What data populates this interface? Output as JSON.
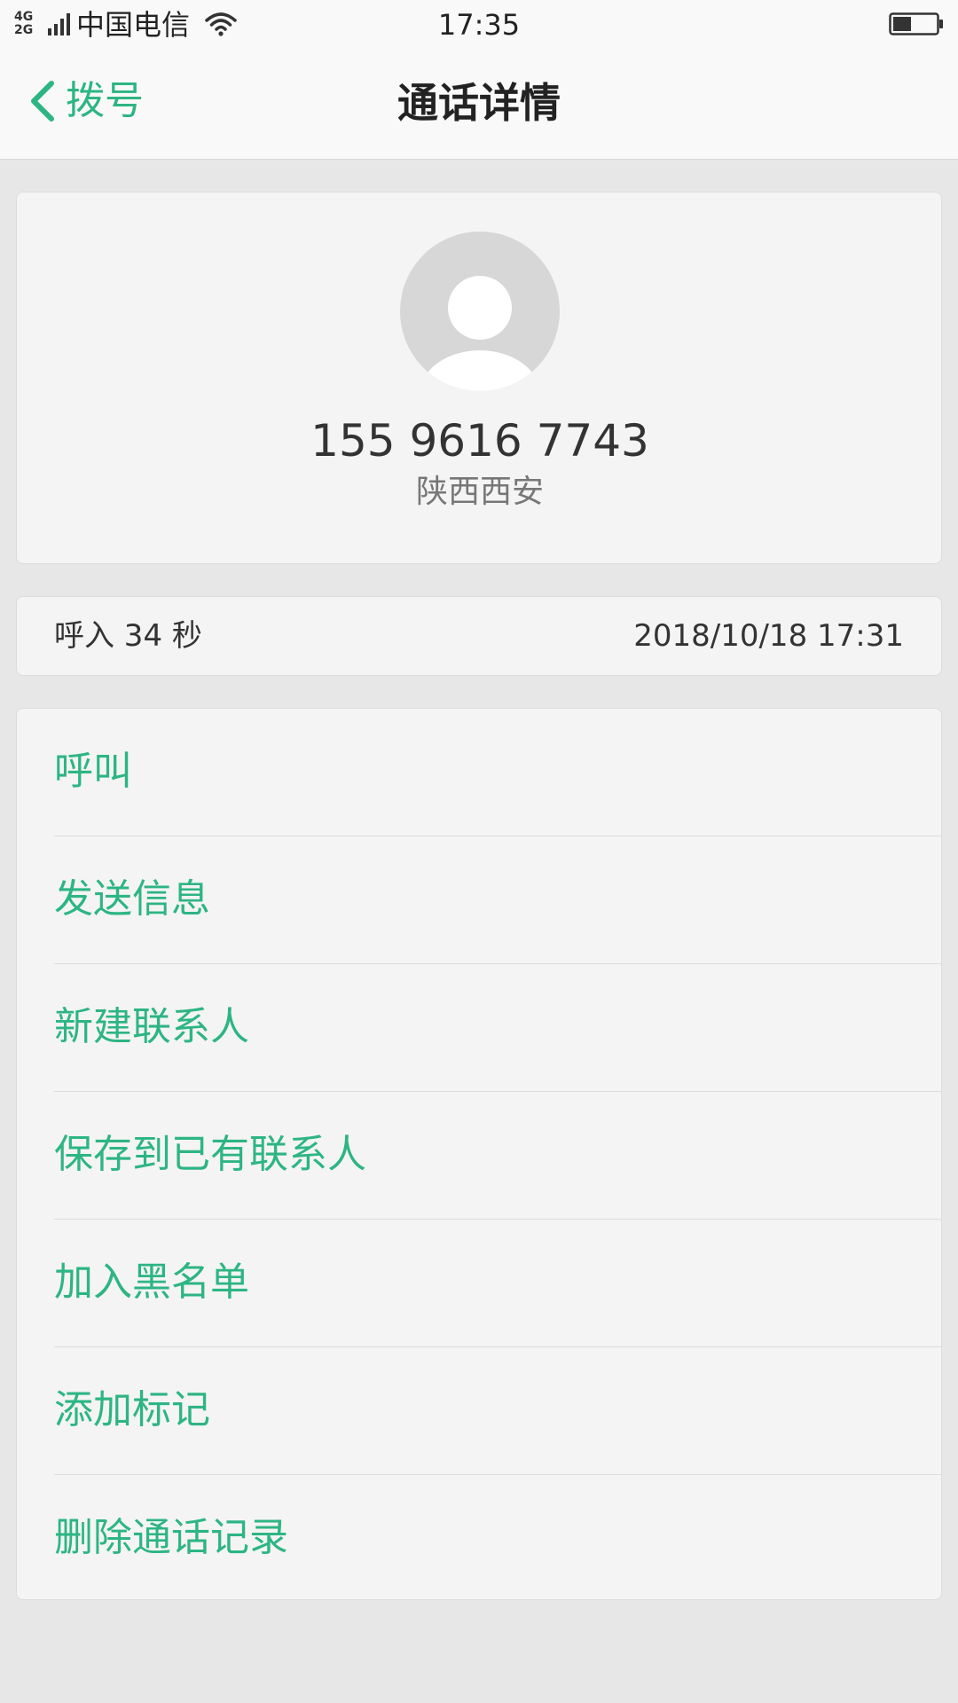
{
  "status_bar": {
    "network_top": "4G",
    "network_bottom": "2G",
    "carrier": "中国电信",
    "time": "17:35",
    "icons": [
      "signal-icon",
      "wifi-icon",
      "battery-icon"
    ]
  },
  "header": {
    "back_label": "拨号",
    "title": "通话详情"
  },
  "contact": {
    "phone_number": "155 9616 7743",
    "location": "陕西西安",
    "avatar_icon": "default-avatar-icon"
  },
  "call_record": {
    "type_duration": "呼入  34 秒",
    "datetime": "2018/10/18 17:31"
  },
  "actions": [
    {
      "label": "呼叫"
    },
    {
      "label": "发送信息"
    },
    {
      "label": "新建联系人"
    },
    {
      "label": "保存到已有联系人"
    },
    {
      "label": "加入黑名单"
    },
    {
      "label": "添加标记"
    },
    {
      "label": "删除通话记录"
    }
  ],
  "colors": {
    "accent": "#2db584",
    "background": "#e7e7e7",
    "card": "#f4f4f4"
  }
}
